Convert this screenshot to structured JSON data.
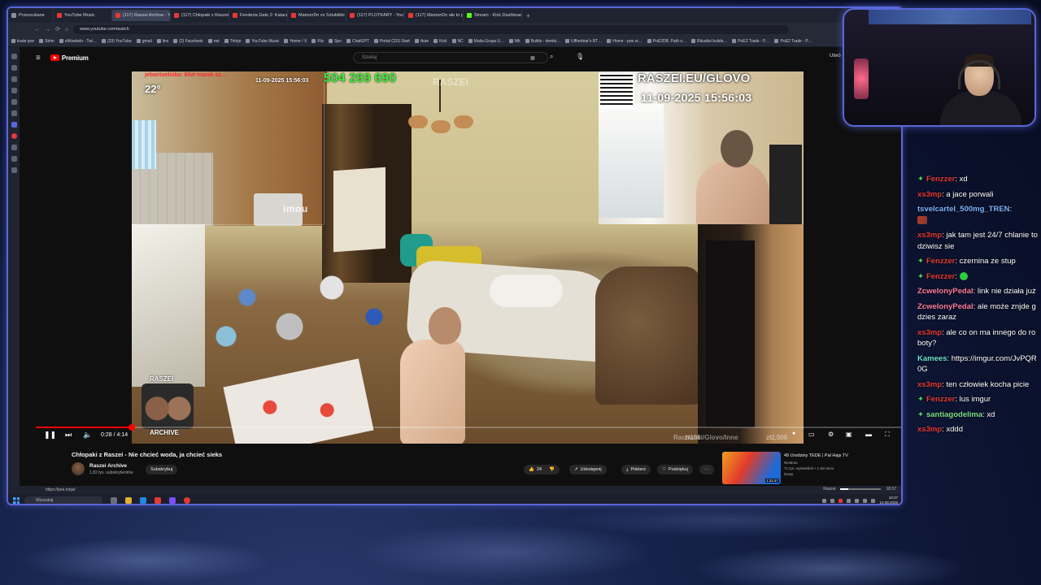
{
  "browser": {
    "tabs": [
      {
        "label": "Przeszukane",
        "active": false
      },
      {
        "label": "YouTube Music",
        "active": false
      },
      {
        "label": "(117) Raszei Archive - You…",
        "active": true
      },
      {
        "label": "(117) Chłopaki z Raszei - N…",
        "active": false
      },
      {
        "label": "Fenderia Gate 2: Katarzyna…",
        "active": false
      },
      {
        "label": "MamonDn vs Sztubibbi - Yo…",
        "active": false
      },
      {
        "label": "(117) PLOTKARY - YouTube",
        "active": false
      },
      {
        "label": "(117) MamonDn ale to pop…",
        "active": false
      },
      {
        "label": "Stream - Kick Dashboard",
        "active": false
      }
    ],
    "new_tab": "+",
    "url": "www.youtube.com/watch",
    "bookmarks": [
      "trade poe",
      "Strim",
      "eWsebelo - Twi…",
      "(33) YouTube",
      "gmail",
      "lins",
      "(2) Facebook",
      "net",
      "Tritnjo",
      "YouTube Music",
      "Home / X",
      "Flix",
      "Spo",
      "ChatGPT",
      "Portal CDS Start",
      "Aute",
      "Kick",
      "NC",
      "Malia Grupa U…",
      "Mit",
      "Builds - itembi…",
      "Ulfhednar's RT…",
      "Home - poe.ni…",
      "PoE2DB, Path o…",
      "Ritualist builds…",
      "PoE2 Trade - P…",
      "PoE2 Trade - P…"
    ],
    "status_url": "https://poe.ninja/"
  },
  "youtube": {
    "logo_text": "Premium",
    "search_placeholder": "Szukaj",
    "top_right": "Utwó",
    "video_overlays": {
      "red_text": "jebactuelnika: 60zł   marak sz…",
      "temperature": "22°",
      "small_datetime": "11-09-2025 15:56:03",
      "money": "504 269 690",
      "faint_brand": "RASZEI",
      "site": "RASZEI.EU/GLOVO",
      "big_datetime": "11-09-2025 15:56:03",
      "camera_brand": "imou",
      "badge_top": "RASZEI",
      "badge_bottom": "ARCHIVE",
      "bottom_mid": "Rachunki/Glovo/Inne",
      "bottom_amount1": "zł106",
      "bottom_amount2": "zł2,500"
    },
    "player": {
      "time_current": "0:28",
      "time_separator": "/",
      "time_total": "4:14",
      "progress_fraction": 0.11
    },
    "video_title": "Chłopaki z Raszei - Nie chcieć woda, ja chcieć sieks",
    "channel": {
      "name": "Raszei Archive",
      "subs": "1,82 tys. subskrybentów"
    },
    "subscribe_label": "Subskrybuj",
    "actions": {
      "likes": "24",
      "share": "Udostępnij",
      "download": "Pobierz",
      "thanks": "Podziękuj",
      "more": "···"
    },
    "recommendation": {
      "title": "49 Urodziny TEDE | Pal Hajs TV",
      "channel": "WoMoto",
      "views": "71 tys. wyświetleń • 2 dni temu",
      "badge": "Nowy",
      "duration": "1:22:47"
    }
  },
  "taskbar": {
    "search_placeholder": "Wyszukaj",
    "clock_time": "18:37",
    "clock_date": "14.09.2025"
  },
  "media_strip": {
    "label": "Raszei"
  },
  "chat": {
    "messages": [
      {
        "badge": true,
        "user": "Fenzzer",
        "color": "#e53935",
        "text": ": xd"
      },
      {
        "badge": false,
        "user": "xs3mp",
        "color": "#e53935",
        "text": ": a jace porwali"
      },
      {
        "badge": false,
        "user": "tsvelcartel_500mg_TREN",
        "color": "#7fb3ff",
        "text": ":",
        "emote": true
      },
      {
        "badge": false,
        "user": "xs3mp",
        "color": "#e53935",
        "text": ": jak tam jest 24/7 chlanie to dziwisz sie"
      },
      {
        "badge": true,
        "user": "Fenzzer",
        "color": "#e53935",
        "text": ": czernina ze stup"
      },
      {
        "badge": true,
        "user": "Fenzzer",
        "color": "#e53935",
        "text": ":",
        "emote_green": true
      },
      {
        "badge": false,
        "user": "ZcwelonyPedal",
        "color": "#ff7b9c",
        "text": ": link nie działa już"
      },
      {
        "badge": false,
        "user": "ZcwelonyPedal",
        "color": "#ff7b9c",
        "text": ": ale może znjde gdzies zaraz"
      },
      {
        "badge": false,
        "user": "xs3mp",
        "color": "#e53935",
        "text": ": ale co on ma innego do roboty?"
      },
      {
        "badge": false,
        "user": "Kamees",
        "color": "#6fe3d1",
        "text": ": https://imgur.com/JvPQR0G"
      },
      {
        "badge": false,
        "user": "xs3mp",
        "color": "#e53935",
        "text": ": ten człowiek kocha picie"
      },
      {
        "badge": true,
        "user": "Fenzzer",
        "color": "#e53935",
        "text": ": lus imgur"
      },
      {
        "badge": true,
        "user": "santiagodelima",
        "color": "#7ee08a",
        "text": ": xd"
      },
      {
        "badge": false,
        "user": "xs3mp",
        "color": "#e53935",
        "text": ": xddd"
      }
    ]
  },
  "colors": {
    "accent": "#5a67d8",
    "yt_red": "#ff0000",
    "money_green": "#3be83b",
    "badge_green": "#4cd964"
  }
}
